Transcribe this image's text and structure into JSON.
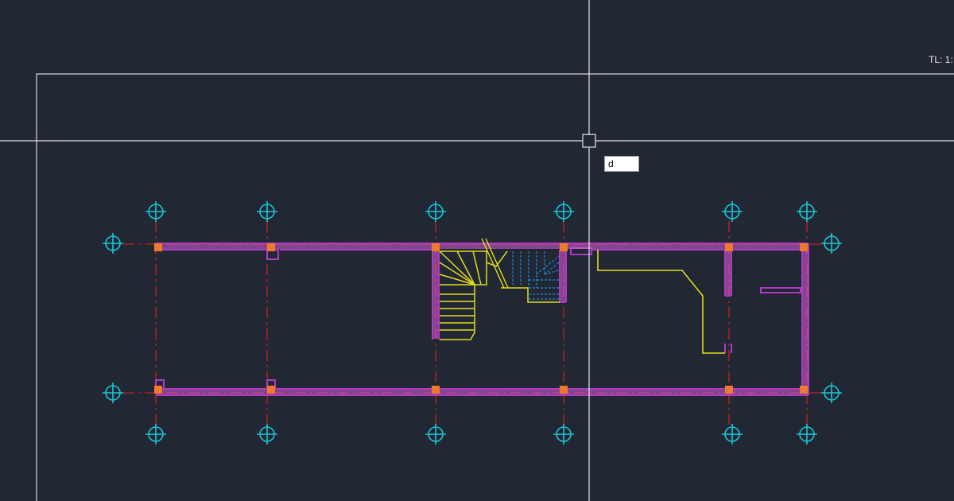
{
  "canvas": {
    "scale_label": "TL: 1:",
    "command_input_value": "d"
  },
  "colors": {
    "background": "#212733",
    "wall": "#b03ac6",
    "wall_hatch": "#d45fd6",
    "column": "#f07a2b",
    "grid_line": "#a8241f",
    "axis_bubble": "#19c7d6",
    "stair": "#e3dd1c",
    "stair_hidden": "#1b8de0",
    "crosshair": "#e6e6e6",
    "frame": "#d8d8d8"
  }
}
